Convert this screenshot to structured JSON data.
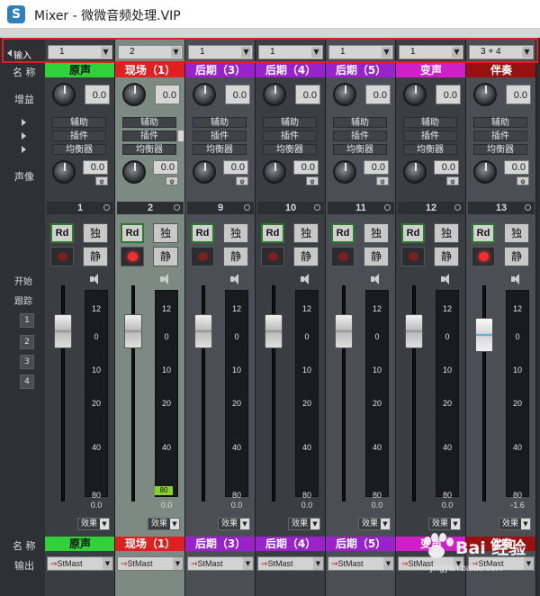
{
  "window": {
    "app_icon": "S",
    "title": "Mixer - 微微音频处理.VIP"
  },
  "left": {
    "input_label": "输入",
    "name_label": "名 称",
    "gain_label": "增益",
    "pan_label": "声像",
    "start_label": "开始",
    "track_label": "跟踪",
    "track_buttons": [
      "1",
      "2",
      "3",
      "4"
    ],
    "name_label_bottom": "名 称",
    "output_label": "输出"
  },
  "send_labels": [
    "辅助",
    "插件",
    "均衡器"
  ],
  "meter_scale": [
    "12",
    "0",
    "10",
    "20",
    "40",
    "80"
  ],
  "fx_label": "效果",
  "channels": [
    {
      "input": "1",
      "name": "原声",
      "name_color": "#2fd23a",
      "name_text": "#101010",
      "gain": "0.0",
      "pan": "0.0",
      "pan_sym": "φ",
      "num": "1",
      "rd": "Rd",
      "solo": "独",
      "mute": "静",
      "rec": false,
      "level_text": "0.0",
      "output": "StMast",
      "selected": false,
      "alt": false
    },
    {
      "input": "2",
      "name": "现场（1）",
      "name_color": "#e02020",
      "name_text": "#ffffff",
      "gain": "0.0",
      "pan": "0.0",
      "pan_sym": "φ",
      "num": "2",
      "rd": "Rd",
      "solo": "独",
      "mute": "静",
      "rec": true,
      "level_text": "0.0",
      "led": "80",
      "output": "StMast",
      "selected": true,
      "alt": false
    },
    {
      "input": "1",
      "name": "后期（3）",
      "name_color": "#9a22cc",
      "name_text": "#ffffff",
      "gain": "0.0",
      "pan": "0.0",
      "pan_sym": "φ",
      "num": "9",
      "rd": "Rd",
      "solo": "独",
      "mute": "静",
      "rec": false,
      "level_text": "0.0",
      "output": "StMast",
      "selected": false,
      "alt": true
    },
    {
      "input": "1",
      "name": "后期（4）",
      "name_color": "#9a22cc",
      "name_text": "#ffffff",
      "gain": "0.0",
      "pan": "0.0",
      "pan_sym": "φ",
      "num": "10",
      "rd": "Rd",
      "solo": "独",
      "mute": "静",
      "rec": false,
      "level_text": "0.0",
      "output": "StMast",
      "selected": false,
      "alt": false
    },
    {
      "input": "1",
      "name": "后期（5）",
      "name_color": "#9a22cc",
      "name_text": "#ffffff",
      "gain": "0.0",
      "pan": "0.0",
      "pan_sym": "φ",
      "num": "11",
      "rd": "Rd",
      "solo": "独",
      "mute": "静",
      "rec": false,
      "level_text": "0.0",
      "output": "StMast",
      "selected": false,
      "alt": true
    },
    {
      "input": "1",
      "name": "变声",
      "name_color": "#d01ec8",
      "name_text": "#ffffff",
      "gain": "0.0",
      "pan": "0.0",
      "pan_sym": "φ",
      "num": "12",
      "rd": "Rd",
      "solo": "独",
      "mute": "静",
      "rec": false,
      "level_text": "0.0",
      "output": "StMast",
      "selected": false,
      "alt": false
    },
    {
      "input": "3 + 4",
      "name": "伴奏",
      "name_color": "#9a1010",
      "name_text": "#ffffff",
      "gain": "0.0",
      "pan": "0.0",
      "pan_sym": "φ",
      "num": "13",
      "rd": "Rd",
      "solo": "独",
      "mute": "静",
      "rec": true,
      "level_text": "-1.6",
      "output": "StMast",
      "selected": false,
      "alt": true
    }
  ],
  "watermark": {
    "main": "Bai 经验",
    "sub": "jingyan.baidu.com"
  }
}
